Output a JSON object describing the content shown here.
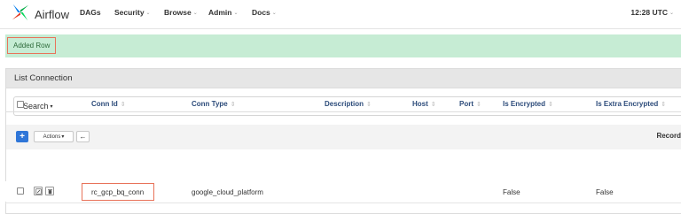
{
  "navbar": {
    "brand": "Airflow",
    "items": [
      {
        "label": "DAGs",
        "has_caret": false
      },
      {
        "label": "Security",
        "has_caret": true
      },
      {
        "label": "Browse",
        "has_caret": true
      },
      {
        "label": "Admin",
        "has_caret": true
      },
      {
        "label": "Docs",
        "has_caret": true
      }
    ],
    "time": "12:28 UTC"
  },
  "alert": {
    "message": "Added Row",
    "color": "#c6ecd4",
    "highlight_color": "#e8735a"
  },
  "panel": {
    "title": "List Connection",
    "search_label": "Search",
    "toolbar": {
      "add_label": "+",
      "actions_label": "Actions",
      "back_icon": "arrow-left-icon",
      "record_label": "Record"
    },
    "columns": [
      "Conn Id",
      "Conn Type",
      "Description",
      "Host",
      "Port",
      "Is Encrypted",
      "Is Extra Encrypted"
    ],
    "rows": [
      {
        "conn_id": "rc_gcp_bq_conn",
        "conn_type": "google_cloud_platform",
        "description": "",
        "host": "",
        "port": "",
        "is_encrypted": "False",
        "is_extra_encrypted": "False"
      }
    ]
  },
  "colors": {
    "primary_button": "#2f76d8",
    "header_text": "#2c4b7a"
  }
}
